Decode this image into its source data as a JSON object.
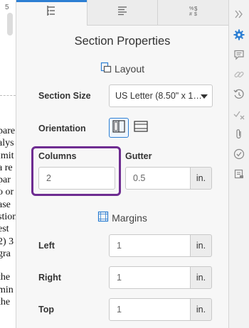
{
  "document": {
    "page_number": "5",
    "text_lines": [
      "pare",
      "alys",
      "imit",
      "a re",
      "par",
      "o or",
      "ase",
      "stion",
      "est",
      "2) 3",
      "gra",
      "",
      "the",
      "min",
      "the"
    ]
  },
  "panel": {
    "tabs": [
      {
        "id": "section",
        "icon": "section-properties-icon",
        "active": true
      },
      {
        "id": "paragraph",
        "icon": "paragraph-align-icon",
        "active": false
      },
      {
        "id": "fields",
        "icon": "fields-icon",
        "active": false,
        "glyph": "%$\n#$"
      }
    ],
    "title": "Section Properties",
    "layout": {
      "heading": "Layout",
      "section_size_label": "Section Size",
      "section_size_value": "US Letter (8.50\" x 1…",
      "orientation_label": "Orientation",
      "orientation_selected": "portrait",
      "columns_label": "Columns",
      "columns_value": "2",
      "gutter_label": "Gutter",
      "gutter_value": "0.5",
      "gutter_unit": "in."
    },
    "margins": {
      "heading": "Margins",
      "left_label": "Left",
      "left_value": "1",
      "right_label": "Right",
      "right_value": "1",
      "top_label": "Top",
      "top_value": "1",
      "unit": "in."
    }
  },
  "sidebar": {
    "icons": [
      "collapse-chevrons-icon",
      "gear-icon",
      "comment-icon",
      "link-icon",
      "history-icon",
      "check-x-icon",
      "paperclip-icon",
      "checkmark-circle-icon",
      "clipboard-icon"
    ],
    "active_icon": "gear-icon"
  },
  "colors": {
    "accent": "#2d7fd3",
    "highlight": "#6e2c91",
    "panel_bg": "#f7f7f7"
  }
}
